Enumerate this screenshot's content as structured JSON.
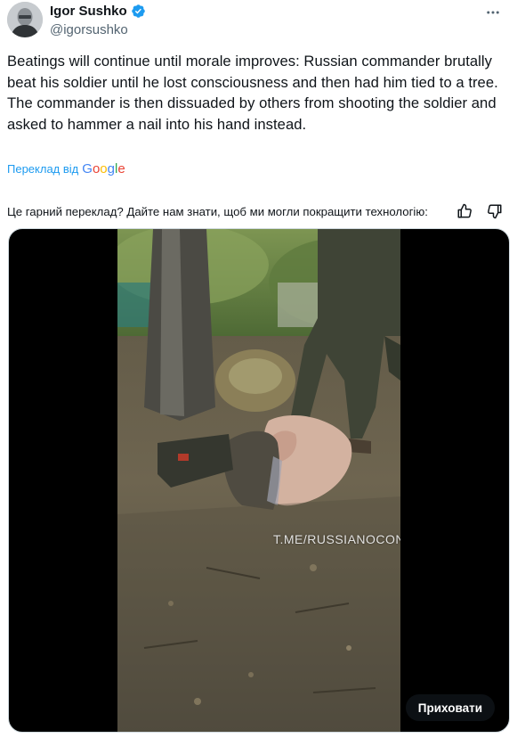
{
  "author": {
    "name": "Igor Sushko",
    "handle": "@igorsushko"
  },
  "tweet": {
    "text_line1": "Beatings will continue until morale improves: Russian commander brutally beat his soldier until he lost consciousness and then had him tied to a tree.",
    "text_line2": "The commander is then dissuaded by others from shooting the soldier and asked to hammer a nail into his hand instead."
  },
  "translation": {
    "translated_by": "Переклад від",
    "google_letters": [
      "G",
      "o",
      "o",
      "g",
      "l",
      "e"
    ],
    "feedback_prompt": "Це гарний переклад? Дайте нам знати, щоб ми могли покращити технологію:"
  },
  "media": {
    "watermark": "T.ME/RUSSIANOCONTEXT",
    "hide_label": "Приховати"
  },
  "icons": {
    "more": "more-dots-icon",
    "verified": "verified-badge-icon",
    "thumbs_up": "thumbs-up-icon",
    "thumbs_down": "thumbs-down-icon"
  },
  "colors": {
    "link_blue": "#1d9bf0",
    "verified_blue": "#1d9bf0",
    "text_primary": "#0f1419",
    "text_secondary": "#536471"
  }
}
